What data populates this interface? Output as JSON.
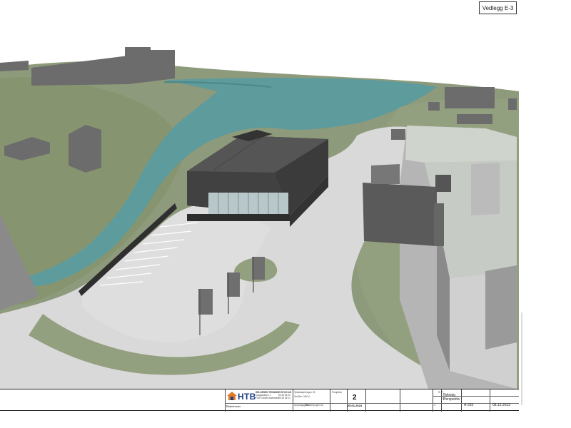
{
  "sheet": {
    "appendix_label": "Vedlegg E-3"
  },
  "company": {
    "logo_text": "HTB",
    "name": "HELGESEN TEKNISKE BYGG AS",
    "address_line1": "Kragsbakken 1",
    "address_line2": "7000 Oslo/Kristiansand",
    "phone": "99 45 65 00",
    "fax": "99 45 65 01"
  },
  "project": {
    "client_label": "Tiltakshaver",
    "address": "Tydalsskjellvegen 25",
    "gnr_bnr": "Gnr/Bnr 146/14",
    "owner_label": "Oppdragsgiver",
    "owner": "Mbakkerjorgen AS"
  },
  "revision": {
    "label": "Prosjektnr",
    "number": "2",
    "date": "25.01.2024"
  },
  "drawing": {
    "status_code": "R-TT",
    "status": "Nybygg",
    "discipline_code": "A1",
    "title": "Perspektiv",
    "scale": "1:",
    "format_label": "A3",
    "number": "A-310",
    "date": "08.12.2023"
  },
  "colors": {
    "sky": "#ffffff",
    "terrain": "#8d9a7b",
    "water": "#5e9b9c",
    "pavement": "#d9d9d9",
    "building_dark": "#3c3c3c",
    "building_light": "#e6e6e6",
    "glass": "#b8c7c9"
  }
}
